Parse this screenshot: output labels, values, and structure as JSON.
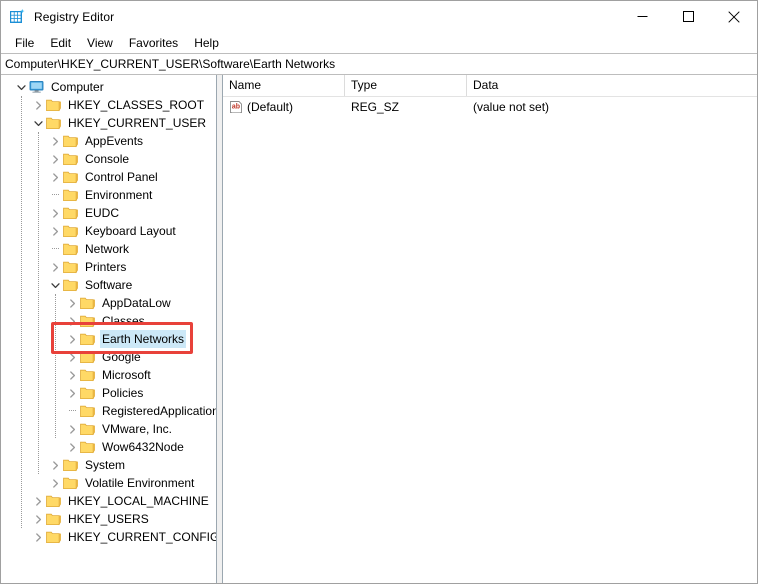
{
  "window": {
    "title": "Registry Editor",
    "icon": "registry-editor-icon",
    "controls": {
      "minimize": "minimize-icon",
      "maximize": "maximize-icon",
      "close": "close-icon"
    }
  },
  "menubar": {
    "items": [
      {
        "label": "File"
      },
      {
        "label": "Edit"
      },
      {
        "label": "View"
      },
      {
        "label": "Favorites"
      },
      {
        "label": "Help"
      }
    ]
  },
  "address": {
    "path": "Computer\\HKEY_CURRENT_USER\\Software\\Earth Networks"
  },
  "tree": {
    "nodes": [
      {
        "label": "Computer",
        "depth": 0,
        "icon": "computer-icon",
        "state": "expanded",
        "selected": false
      },
      {
        "label": "HKEY_CLASSES_ROOT",
        "depth": 1,
        "icon": "folder-icon",
        "state": "collapsed",
        "selected": false
      },
      {
        "label": "HKEY_CURRENT_USER",
        "depth": 1,
        "icon": "folder-icon",
        "state": "expanded",
        "selected": false
      },
      {
        "label": "AppEvents",
        "depth": 2,
        "icon": "folder-icon",
        "state": "collapsed",
        "selected": false
      },
      {
        "label": "Console",
        "depth": 2,
        "icon": "folder-icon",
        "state": "collapsed",
        "selected": false
      },
      {
        "label": "Control Panel",
        "depth": 2,
        "icon": "folder-icon",
        "state": "collapsed",
        "selected": false
      },
      {
        "label": "Environment",
        "depth": 2,
        "icon": "folder-icon",
        "state": "leaf",
        "selected": false
      },
      {
        "label": "EUDC",
        "depth": 2,
        "icon": "folder-icon",
        "state": "collapsed",
        "selected": false
      },
      {
        "label": "Keyboard Layout",
        "depth": 2,
        "icon": "folder-icon",
        "state": "collapsed",
        "selected": false
      },
      {
        "label": "Network",
        "depth": 2,
        "icon": "folder-icon",
        "state": "leaf",
        "selected": false
      },
      {
        "label": "Printers",
        "depth": 2,
        "icon": "folder-icon",
        "state": "collapsed",
        "selected": false
      },
      {
        "label": "Software",
        "depth": 2,
        "icon": "folder-icon",
        "state": "expanded",
        "selected": false
      },
      {
        "label": "AppDataLow",
        "depth": 3,
        "icon": "folder-icon",
        "state": "collapsed",
        "selected": false
      },
      {
        "label": "Classes",
        "depth": 3,
        "icon": "folder-icon",
        "state": "collapsed",
        "selected": false
      },
      {
        "label": "Earth Networks",
        "depth": 3,
        "icon": "folder-icon",
        "state": "collapsed",
        "selected": true
      },
      {
        "label": "Google",
        "depth": 3,
        "icon": "folder-icon",
        "state": "collapsed",
        "selected": false
      },
      {
        "label": "Microsoft",
        "depth": 3,
        "icon": "folder-icon",
        "state": "collapsed",
        "selected": false
      },
      {
        "label": "Policies",
        "depth": 3,
        "icon": "folder-icon",
        "state": "collapsed",
        "selected": false
      },
      {
        "label": "RegisteredApplications",
        "depth": 3,
        "icon": "folder-icon",
        "state": "leaf",
        "selected": false
      },
      {
        "label": "VMware, Inc.",
        "depth": 3,
        "icon": "folder-icon",
        "state": "collapsed",
        "selected": false
      },
      {
        "label": "Wow6432Node",
        "depth": 3,
        "icon": "folder-icon",
        "state": "collapsed",
        "selected": false
      },
      {
        "label": "System",
        "depth": 2,
        "icon": "folder-icon",
        "state": "collapsed",
        "selected": false
      },
      {
        "label": "Volatile Environment",
        "depth": 2,
        "icon": "folder-icon",
        "state": "collapsed",
        "selected": false
      },
      {
        "label": "HKEY_LOCAL_MACHINE",
        "depth": 1,
        "icon": "folder-icon",
        "state": "collapsed",
        "selected": false
      },
      {
        "label": "HKEY_USERS",
        "depth": 1,
        "icon": "folder-icon",
        "state": "collapsed",
        "selected": false
      },
      {
        "label": "HKEY_CURRENT_CONFIG",
        "depth": 1,
        "icon": "folder-icon",
        "state": "collapsed",
        "selected": false
      }
    ]
  },
  "values": {
    "columns": [
      "Name",
      "Type",
      "Data"
    ],
    "rows": [
      {
        "name": "(Default)",
        "type": "REG_SZ",
        "data": "(value not set)",
        "icon": "string-value-icon"
      }
    ]
  },
  "annotation": {
    "target": "Earth Networks",
    "color": "#e8413a"
  },
  "colors": {
    "selection": "#cce8f7",
    "folder": "#ffd966",
    "accent": "#0078d7",
    "annotation": "#e8413a"
  }
}
